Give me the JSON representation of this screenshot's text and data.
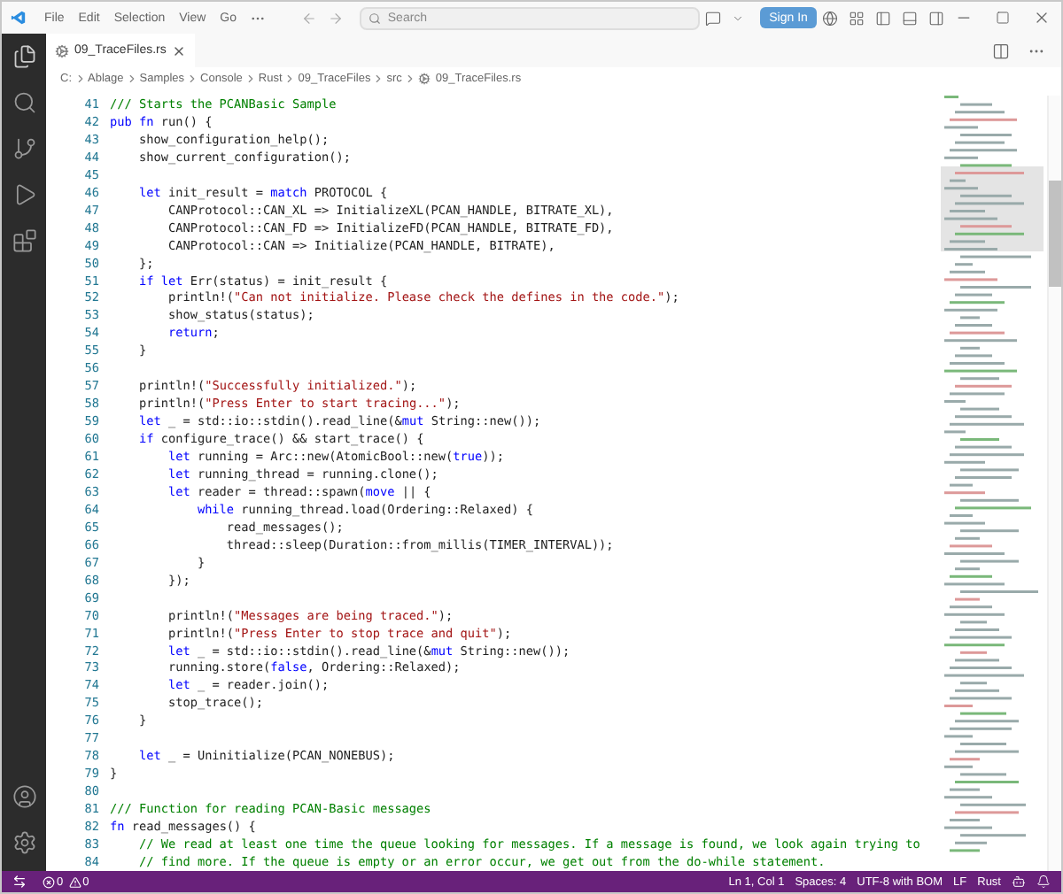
{
  "menu": [
    "File",
    "Edit",
    "Selection",
    "View",
    "Go"
  ],
  "search": {
    "placeholder": "Search"
  },
  "sign_in": "Sign In",
  "tabs": [
    {
      "label": "09_TraceFiles.rs",
      "selected": true
    }
  ],
  "breadcrumb": [
    "C:",
    "Ablage",
    "Samples",
    "Console",
    "Rust",
    "09_TraceFiles",
    "src",
    "09_TraceFiles.rs"
  ],
  "lines": [
    {
      "n": "41",
      "tokens": [
        {
          "kind": "cmt",
          "text": "/// Starts the PCANBasic Sample"
        }
      ]
    },
    {
      "n": "42",
      "tokens": [
        {
          "kind": "kw",
          "text": "pub fn"
        },
        {
          "kind": "p",
          "text": " run() {"
        }
      ]
    },
    {
      "n": "43",
      "tokens": [
        {
          "kind": "p",
          "text": "    show_configuration_help();"
        }
      ]
    },
    {
      "n": "44",
      "tokens": [
        {
          "kind": "p",
          "text": "    show_current_configuration();"
        }
      ]
    },
    {
      "n": "45"
    },
    {
      "n": "46",
      "tokens": [
        {
          "kind": "kw",
          "text": "    let"
        },
        {
          "kind": "p",
          "text": " init_result = "
        },
        {
          "kind": "kw",
          "text": "match"
        },
        {
          "kind": "p",
          "text": " PROTOCOL {"
        }
      ]
    },
    {
      "n": "47",
      "tokens": [
        {
          "kind": "p",
          "text": "        CANProtocol::CAN_XL => InitializeXL(PCAN_HANDLE, BITRATE_XL),"
        }
      ]
    },
    {
      "n": "48",
      "tokens": [
        {
          "kind": "p",
          "text": "        CANProtocol::CAN_FD => InitializeFD(PCAN_HANDLE, BITRATE_FD),"
        }
      ]
    },
    {
      "n": "49",
      "tokens": [
        {
          "kind": "p",
          "text": "        CANProtocol::CAN => Initialize(PCAN_HANDLE, BITRATE),"
        }
      ]
    },
    {
      "n": "50",
      "tokens": [
        {
          "kind": "p",
          "text": "    };"
        }
      ]
    },
    {
      "n": "51",
      "tokens": [
        {
          "kind": "kw",
          "text": "    if let"
        },
        {
          "kind": "p",
          "text": " Err(status) = init_result {"
        }
      ]
    },
    {
      "n": "52",
      "tokens": [
        {
          "kind": "p",
          "text": "        println!("
        },
        {
          "kind": "str",
          "text": "\"Can not initialize. Please check the defines in the code.\""
        },
        {
          "kind": "p",
          "text": ");"
        }
      ]
    },
    {
      "n": "53",
      "tokens": [
        {
          "kind": "p",
          "text": "        show_status(status);"
        }
      ]
    },
    {
      "n": "54",
      "tokens": [
        {
          "kind": "kw",
          "text": "        return"
        },
        {
          "kind": "p",
          "text": ";"
        }
      ]
    },
    {
      "n": "55",
      "tokens": [
        {
          "kind": "p",
          "text": "    }"
        }
      ]
    },
    {
      "n": "56"
    },
    {
      "n": "57",
      "tokens": [
        {
          "kind": "p",
          "text": "    println!("
        },
        {
          "kind": "str",
          "text": "\"Successfully initialized.\""
        },
        {
          "kind": "p",
          "text": ");"
        }
      ]
    },
    {
      "n": "58",
      "tokens": [
        {
          "kind": "p",
          "text": "    println!("
        },
        {
          "kind": "str",
          "text": "\"Press Enter to start tracing...\""
        },
        {
          "kind": "p",
          "text": ");"
        }
      ]
    },
    {
      "n": "59",
      "tokens": [
        {
          "kind": "kw",
          "text": "    let"
        },
        {
          "kind": "p",
          "text": " _ = std::io::stdin().read_line(&"
        },
        {
          "kind": "kw",
          "text": "mut"
        },
        {
          "kind": "p",
          "text": " String::new());"
        }
      ]
    },
    {
      "n": "60",
      "tokens": [
        {
          "kind": "kw",
          "text": "    if"
        },
        {
          "kind": "p",
          "text": " configure_trace() && start_trace() {"
        }
      ]
    },
    {
      "n": "61",
      "tokens": [
        {
          "kind": "kw",
          "text": "        let"
        },
        {
          "kind": "p",
          "text": " running = Arc::new(AtomicBool::new("
        },
        {
          "kind": "kw",
          "text": "true"
        },
        {
          "kind": "p",
          "text": "));"
        }
      ]
    },
    {
      "n": "62",
      "tokens": [
        {
          "kind": "kw",
          "text": "        let"
        },
        {
          "kind": "p",
          "text": " running_thread = running.clone();"
        }
      ]
    },
    {
      "n": "63",
      "tokens": [
        {
          "kind": "kw",
          "text": "        let"
        },
        {
          "kind": "p",
          "text": " reader = thread::spawn("
        },
        {
          "kind": "kw",
          "text": "move"
        },
        {
          "kind": "p",
          "text": " || {"
        }
      ]
    },
    {
      "n": "64",
      "tokens": [
        {
          "kind": "kw",
          "text": "            while"
        },
        {
          "kind": "p",
          "text": " running_thread.load(Ordering::Relaxed) {"
        }
      ]
    },
    {
      "n": "65",
      "tokens": [
        {
          "kind": "p",
          "text": "                read_messages();"
        }
      ]
    },
    {
      "n": "66",
      "tokens": [
        {
          "kind": "p",
          "text": "                thread::sleep(Duration::from_millis(TIMER_INTERVAL));"
        }
      ]
    },
    {
      "n": "67",
      "tokens": [
        {
          "kind": "p",
          "text": "            }"
        }
      ]
    },
    {
      "n": "68",
      "tokens": [
        {
          "kind": "p",
          "text": "        });"
        }
      ]
    },
    {
      "n": "69"
    },
    {
      "n": "70",
      "tokens": [
        {
          "kind": "p",
          "text": "        println!("
        },
        {
          "kind": "str",
          "text": "\"Messages are being traced.\""
        },
        {
          "kind": "p",
          "text": ");"
        }
      ]
    },
    {
      "n": "71",
      "tokens": [
        {
          "kind": "p",
          "text": "        println!("
        },
        {
          "kind": "str",
          "text": "\"Press Enter to stop trace and quit\""
        },
        {
          "kind": "p",
          "text": ");"
        }
      ]
    },
    {
      "n": "72",
      "tokens": [
        {
          "kind": "kw",
          "text": "        let"
        },
        {
          "kind": "p",
          "text": " _ = std::io::stdin().read_line(&"
        },
        {
          "kind": "kw",
          "text": "mut"
        },
        {
          "kind": "p",
          "text": " String::new());"
        }
      ]
    },
    {
      "n": "73",
      "tokens": [
        {
          "kind": "p",
          "text": "        running.store("
        },
        {
          "kind": "kw",
          "text": "false"
        },
        {
          "kind": "p",
          "text": ", Ordering::Relaxed);"
        }
      ]
    },
    {
      "n": "74",
      "tokens": [
        {
          "kind": "kw",
          "text": "        let"
        },
        {
          "kind": "p",
          "text": " _ = reader.join();"
        }
      ]
    },
    {
      "n": "75",
      "tokens": [
        {
          "kind": "p",
          "text": "        stop_trace();"
        }
      ]
    },
    {
      "n": "76",
      "tokens": [
        {
          "kind": "p",
          "text": "    }"
        }
      ]
    },
    {
      "n": "77"
    },
    {
      "n": "78",
      "tokens": [
        {
          "kind": "kw",
          "text": "    let"
        },
        {
          "kind": "p",
          "text": " _ = Uninitialize(PCAN_NONEBUS);"
        }
      ]
    },
    {
      "n": "79",
      "tokens": [
        {
          "kind": "p",
          "text": "}"
        }
      ]
    },
    {
      "n": "80"
    },
    {
      "n": "81",
      "tokens": [
        {
          "kind": "cmt",
          "text": "/// Function for reading PCAN-Basic messages"
        }
      ]
    },
    {
      "n": "82",
      "tokens": [
        {
          "kind": "kw",
          "text": "fn"
        },
        {
          "kind": "p",
          "text": " read_messages() {"
        }
      ]
    },
    {
      "n": "83",
      "tokens": [
        {
          "kind": "cmt",
          "text": "    // We read at least one time the queue looking for messages. If a message is found, we look again trying to"
        }
      ]
    },
    {
      "n": "84",
      "tokens": [
        {
          "kind": "cmt",
          "text": "    // find more. If the queue is empty or an error occur, we get out from the do-while statement."
        }
      ]
    }
  ],
  "status_bar": {
    "errors": "0",
    "warnings": "0",
    "items": [
      "Ln 1, Col 1",
      "Spaces: 4",
      "UTF-8 with BOM",
      "LF",
      "Rust"
    ]
  }
}
